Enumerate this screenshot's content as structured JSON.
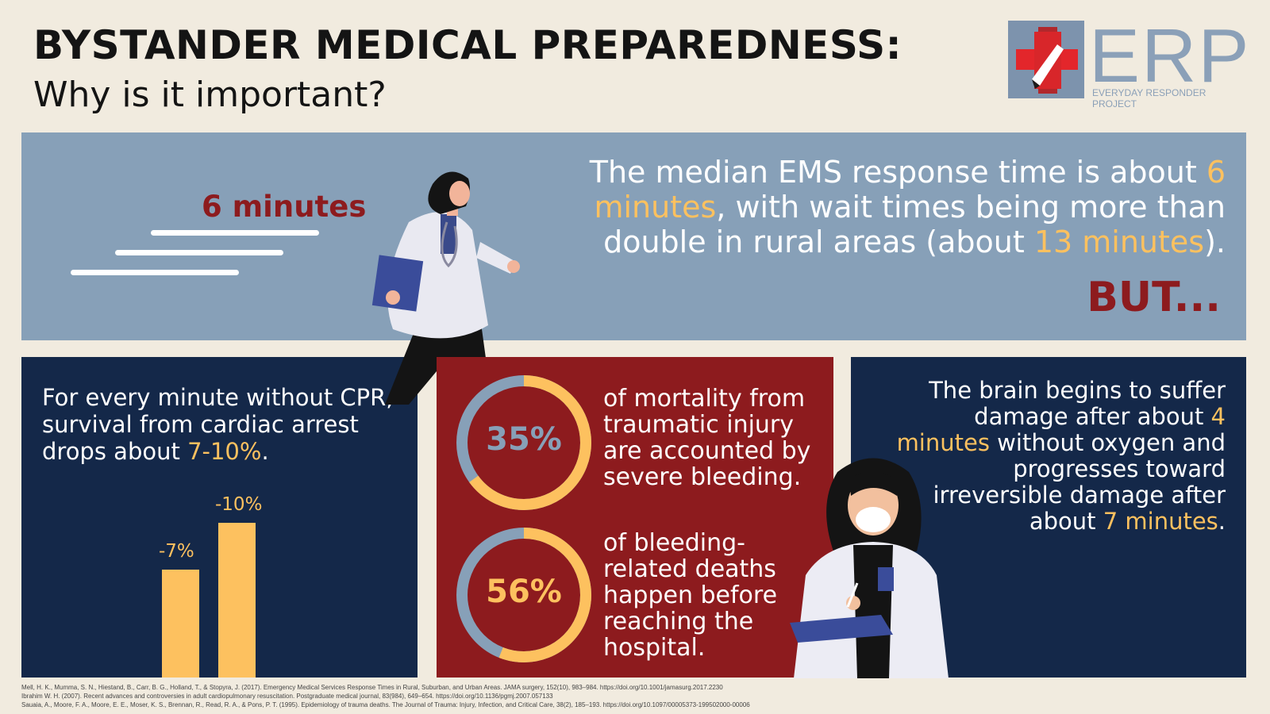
{
  "header": {
    "title": "BYSTANDER MEDICAL PREPAREDNESS:",
    "subtitle": "Why is it important?"
  },
  "logo": {
    "letters": "ERP",
    "tagline": "EVERYDAY RESPONDER PROJECT",
    "icon": "red-cross-building-icon"
  },
  "banner": {
    "big_label": "6 minutes",
    "text_parts": [
      "The median EMS response time is about ",
      "6 minutes",
      ", with wait times being more than double in rural areas (about ",
      "13 minutes",
      ")."
    ],
    "but": "BUT..."
  },
  "cpr_panel": {
    "text_parts": [
      "For every minute without CPR, survival from cardiac arrest drops about ",
      "7-10%",
      "."
    ],
    "bars": [
      {
        "label": "-7%",
        "value": -7
      },
      {
        "label": "-10%",
        "value": -10
      }
    ]
  },
  "bleeding_panel": {
    "stats": [
      {
        "pct_label": "35%",
        "pct": 35,
        "text": "of mortality from traumatic injury are accounted by severe bleeding."
      },
      {
        "pct_label": "56%",
        "pct": 56,
        "text": "of bleeding-related deaths happen before reaching the hospital."
      }
    ]
  },
  "brain_panel": {
    "text_parts": [
      "The brain begins to suffer damage after about ",
      "4 minutes",
      " without oxygen and progresses toward irreversible damage after about ",
      "7 minutes",
      "."
    ]
  },
  "references": [
    "Mell, H. K., Mumma, S. N., Hiestand, B., Carr, B. G., Holland, T., & Stopyra, J. (2017). Emergency Medical Services Response Times in Rural, Suburban, and Urban Areas. JAMA surgery, 152(10), 983–984. https://doi.org/10.1001/jamasurg.2017.2230",
    "Ibrahim W. H. (2007). Recent advances and controversies in adult cardiopulmonary resuscitation. Postgraduate medical journal, 83(984), 649–654. https://doi.org/10.1136/pgmj.2007.057133",
    "Sauaia, A., Moore, F. A., Moore, E. E., Moser, K. S., Brennan, R., Read, R. A., & Pons, P. T. (1995). Epidemiology of trauma deaths. The Journal of Trauma: Injury, Infection, and Critical Care, 38(2), 185–193. https://doi.org/10.1097/00005373-199502000-00006"
  ],
  "colors": {
    "background": "#f1ebdf",
    "steel_blue": "#87a0b8",
    "navy": "#142849",
    "crimson": "#8d1b1e",
    "gold": "#fdc15f"
  }
}
